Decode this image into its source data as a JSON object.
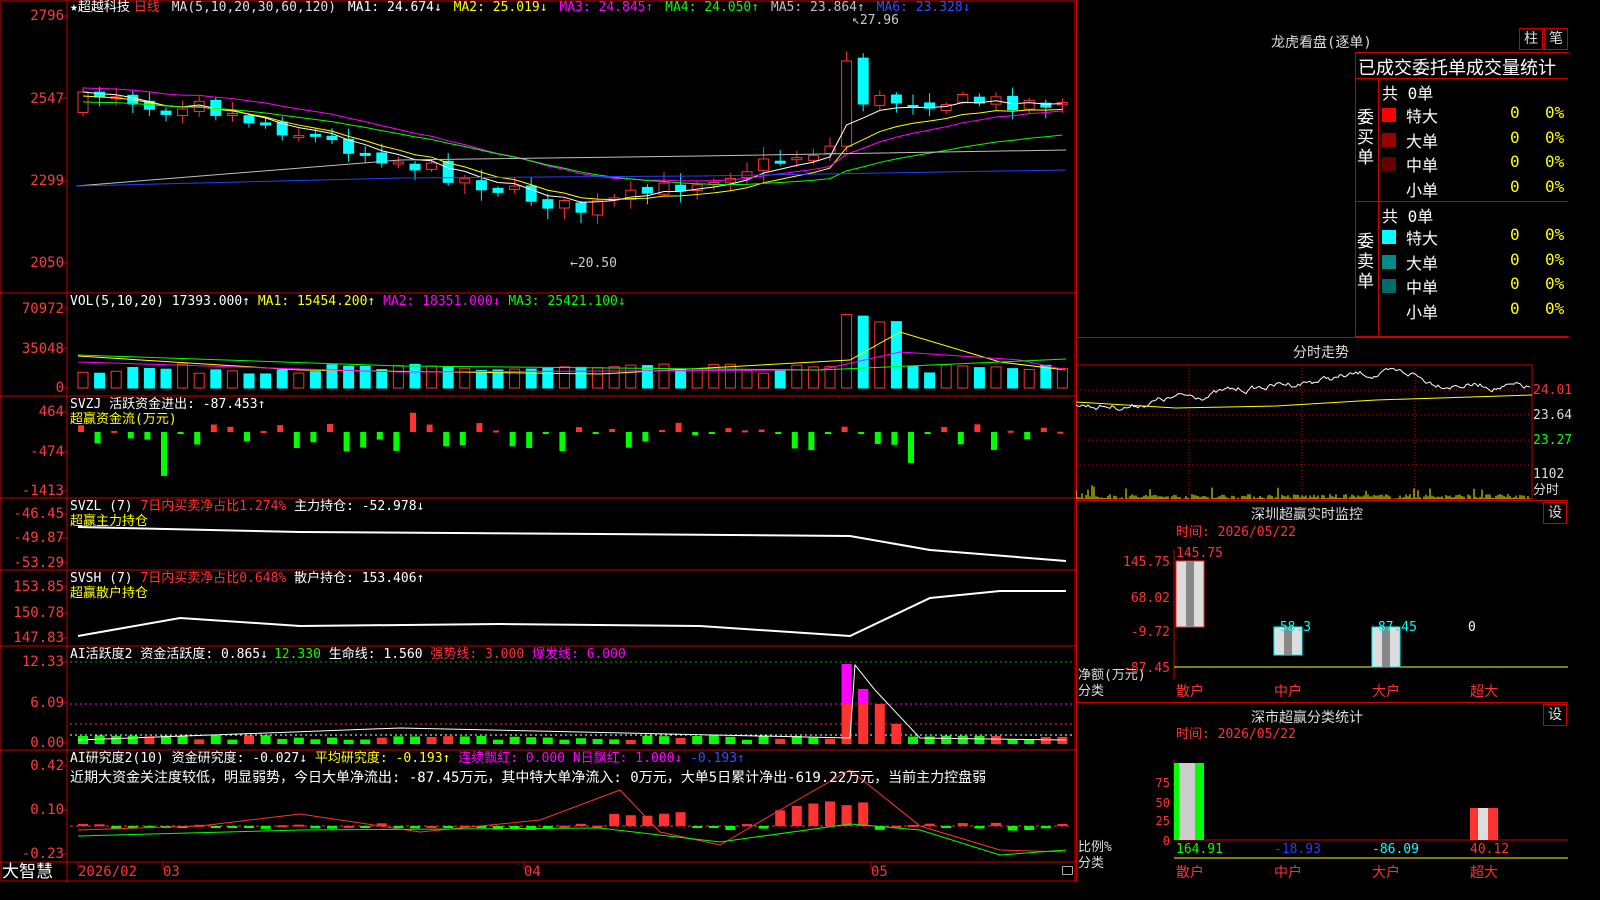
{
  "main_chart": {
    "star": "★",
    "stock_name": "超越科技",
    "period": "日线",
    "ma_params": "MA(5,10,20,30,60,120)",
    "ma1": "MA1: 24.674↓",
    "ma2": "MA2: 25.019↓",
    "ma3": "MA3: 24.845↑",
    "ma4": "MA4: 24.050↑",
    "ma5": "MA5: 23.864↑",
    "ma6": "MA6: 23.328↓",
    "high_note": "27.96",
    "low_note": "←20.50",
    "y_labels": [
      "2796",
      "2547",
      "2299",
      "2050"
    ],
    "colors": {
      "up": "#ff3232",
      "down": "#00ffff",
      "ma1": "#ffffff",
      "ma2": "#ffff00",
      "ma3": "#ff00ff",
      "ma4": "#00ff00",
      "ma5": "#c0c0c0",
      "ma6": "#0000ff"
    }
  },
  "vol": {
    "title": "VOL(5,10,20) 17393.000↑",
    "ma1": "MA1: 15454.200↑",
    "ma2": "MA2: 18351.000↓",
    "ma3": "MA3: 25421.100↓",
    "y_labels": [
      "70972",
      "35048",
      "0"
    ]
  },
  "svzj": {
    "title": "SVZJ  活跃资金进出: -87.453↑",
    "subtitle": "超赢资金流(万元)",
    "y_labels": [
      "464",
      "-474",
      "-1413"
    ]
  },
  "svzl": {
    "title": "SVZL (7)",
    "ratio": "7日内买卖净占比1.274%",
    "main_hold": "主力持仓: -52.978↓",
    "subtitle": "超赢主力持仓",
    "y_labels": [
      "-46.45",
      "-49.87",
      "-53.29"
    ]
  },
  "svsh": {
    "title": "SVSH (7)",
    "ratio": "7日内买卖净占比0.648%",
    "retail_hold": "散户持仓: 153.406↑",
    "subtitle": "超赢散户持仓",
    "y_labels": [
      "153.85",
      "150.78",
      "147.83"
    ]
  },
  "ai_active": {
    "title": "AI活跃度2",
    "active": "资金活跃度: 0.865↓",
    "value2": "12.330",
    "life": "生命线: 1.560",
    "strong": "强势线: 3.000",
    "burst": "爆发线: 6.000",
    "y_labels": [
      "12.33",
      "6.09",
      "0.00"
    ]
  },
  "ai_research": {
    "title": "AI研究度2(10)",
    "research": "资金研究度: -0.027↓",
    "avg": "平均研究度: -0.193↑",
    "lianxu": "连续飘红: 0.000",
    "nri": "N日飘红: 1.000↓",
    "last": "-0.193↑",
    "comment": "近期大资金关注度较低，明显弱势，今日大单净流出: -87.45万元，其中特大单净流入: 0万元，大单5日累计净出-619.22万元，当前主力控盘弱",
    "y_labels": [
      "0.42",
      "0.10",
      "-0.23"
    ]
  },
  "bottom_bar": {
    "brand": "大智慧",
    "dates": [
      "2026/02",
      "03",
      "04",
      "05"
    ]
  },
  "right": {
    "longhu_title": "龙虎看盘(逐单)",
    "btn_zhu": "柱",
    "btn_bi": "笔",
    "stats_title": "已成交委托单成交量统计",
    "buy_label": "委买单",
    "sell_label": "委卖单",
    "buy_total": "共 0单",
    "sell_total": "共 0单",
    "buy_rows": [
      {
        "name": "特大",
        "count": "0",
        "pct": "0%",
        "color": "#ff0000"
      },
      {
        "name": "大单",
        "count": "0",
        "pct": "0%",
        "color": "#990000"
      },
      {
        "name": "中单",
        "count": "0",
        "pct": "0%",
        "color": "#660000"
      },
      {
        "name": "小单",
        "count": "0",
        "pct": "0%",
        "color": "#000000"
      }
    ],
    "sell_rows": [
      {
        "name": "特大",
        "count": "0",
        "pct": "0%",
        "color": "#00ffff"
      },
      {
        "name": "大单",
        "count": "0",
        "pct": "0%",
        "color": "#008b8b"
      },
      {
        "name": "中单",
        "count": "0",
        "pct": "0%",
        "color": "#006b6b"
      },
      {
        "name": "小单",
        "count": "0",
        "pct": "0%",
        "color": "#000000"
      }
    ],
    "fenshi_title": "分时走势",
    "fenshi_labels": [
      "24.01",
      "23.64",
      "23.27",
      "1102",
      "分时"
    ],
    "monitor_title": "深圳超赢实时监控",
    "btn_she": "设",
    "monitor_time": "时间: 2026/05/22",
    "monitor_y": [
      "145.75",
      "68.02",
      "-9.72",
      "-87.45"
    ],
    "monitor_values": [
      "145.75",
      "-58.3",
      "-87.45",
      "0"
    ],
    "monitor_axis": "净额(万元)",
    "monitor_axis2": "分类",
    "monitor_cats": [
      "散户",
      "中户",
      "大户",
      "超大"
    ],
    "class_title": "深市超赢分类统计",
    "class_time": "时间: 2026/05/22",
    "class_y": [
      "75",
      "50",
      "25",
      "0"
    ],
    "class_values": [
      "164.91",
      "-18.93",
      "-86.09",
      "40.12"
    ],
    "class_axis": "比例%",
    "class_axis2": "分类",
    "class_cats": [
      "散户",
      "中户",
      "大户",
      "超大"
    ]
  }
}
